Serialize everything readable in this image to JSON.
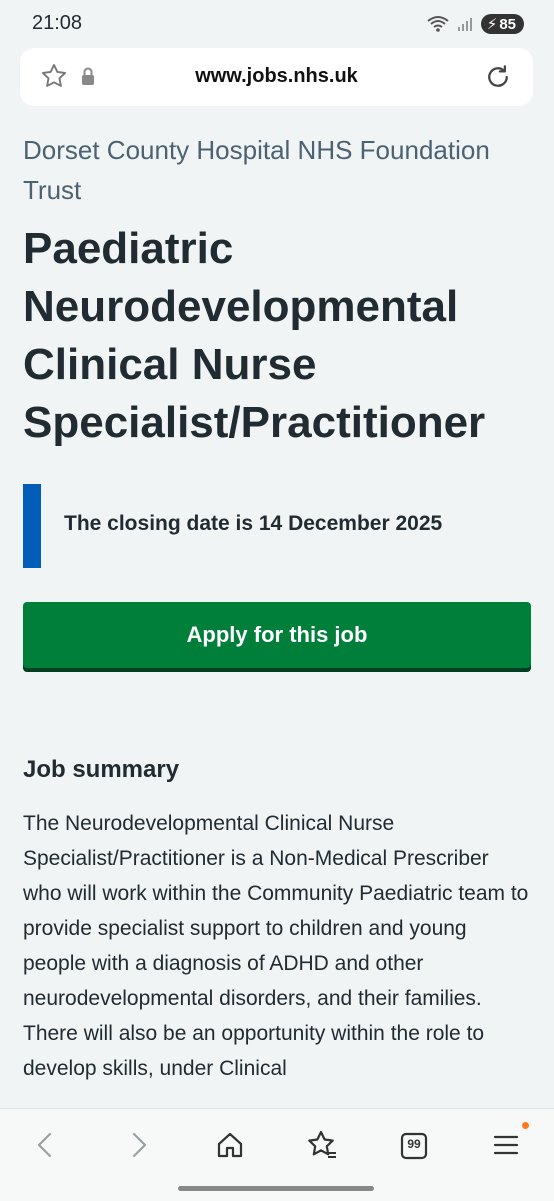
{
  "status": {
    "time": "21:08",
    "battery": "85"
  },
  "browser": {
    "url": "www.jobs.nhs.uk"
  },
  "job": {
    "organisation": "Dorset County Hospital NHS Foundation Trust",
    "title": "Paediatric Neurodevelopmental Clinical Nurse Specialist/Practitioner",
    "closing_date": "The closing date is 14 December 2025",
    "apply_label": "Apply for this job",
    "summary_heading": "Job summary",
    "summary_text": "The Neurodevelopmental Clinical Nurse Specialist/Practitioner is a Non-Medical Prescriber who will work within the Community Paediatric team to provide specialist support to children and young people with a diagnosis of ADHD and other neurodevelopmental disorders, and their families. There will also be an opportunity within the role to develop skills, under Clinical"
  },
  "bottom_nav": {
    "tabs_count": "99"
  },
  "colors": {
    "nhs_blue": "#005eb8",
    "nhs_green": "#007f3b",
    "text": "#212b32",
    "secondary_text": "#4c6272"
  }
}
